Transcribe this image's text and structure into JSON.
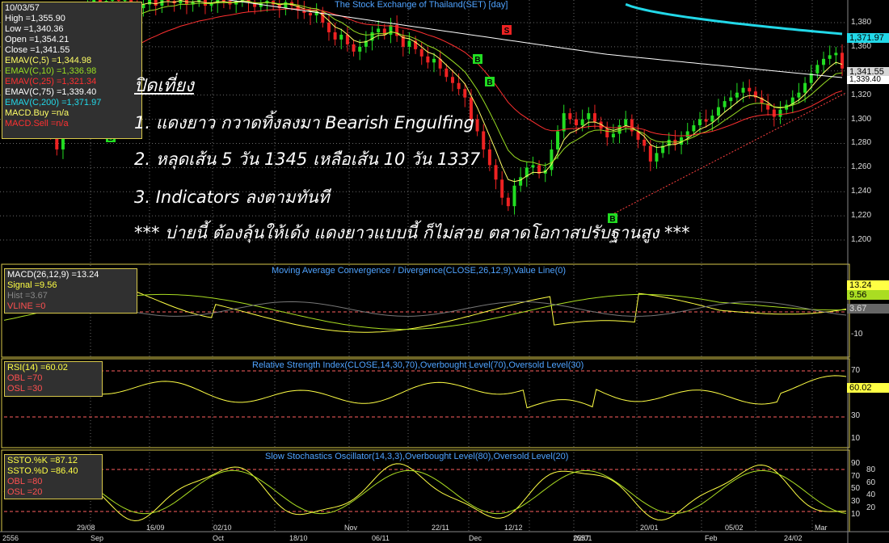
{
  "colors": {
    "up": "#22dd22",
    "down": "#ee2222",
    "grid": "#6a6a6a",
    "panel_border": "#d8c84a",
    "title": "#4fa3ff",
    "ema5": "#ffff66",
    "ema10": "#99dd22",
    "ema25": "#ff3030",
    "ema75": "#ffffff",
    "ema200": "#22d8e8",
    "macd": "#ffff44",
    "signal": "#aadd22",
    "trend": "#ff4040"
  },
  "header": {
    "title": "The Stock Exchange of Thailand(SET) [day]"
  },
  "info_box": {
    "date": "10/03/57",
    "high": "High =1,355.90",
    "low": "Low =1,340.36",
    "open": "Open =1,354.21",
    "close": "Close =1,341.55",
    "ema5": "EMAV(C,5) =1,344.98",
    "ema10": "EMAV(C,10) =1,336.98",
    "ema25": "EMAV(C,25) =1,321.34",
    "ema75": "EMAV(C,75) =1,339.40",
    "ema200": "EMAV(C,200) =1,371.97",
    "macd_buy": "MACD.Buy =n/a",
    "macd_sell": "MACD.Sell =n/a"
  },
  "annotation": {
    "heading": "ปิดเที่ยง",
    "line1": "1. แดงยาว กวาดทิ้งลงมา Bearish Engulfing",
    "line2": "2. หลุดเส้น 5 วัน 1345 เหลือเส้น 10 วัน 1337",
    "line3": "3. Indicators ลงตามทันที",
    "line4": "*** บ่ายนี้ ต้องลุ้นให้เด้ง แดงยาวแบบนี้ ก็ไม่สวย ตลาดโอกาสปรับฐานสูง ***"
  },
  "price_axis": {
    "ticks": [
      "1,380",
      "1,360",
      "1,340",
      "1,320",
      "1,300",
      "1,280",
      "1,260",
      "1,240",
      "1,220",
      "1,200"
    ],
    "badge_ema200": "1,371.97",
    "badge_close": "1,341.55",
    "badge_ema75": "1,339.40"
  },
  "signals": {
    "buy_label": "B",
    "sell_label": "S"
  },
  "macd_panel": {
    "title": "Moving Average Convergence / Divergence(CLOSE,26,12,9),Value Line(0)",
    "macd": "MACD(26,12,9) =13.24",
    "signal": "Signal =9.56",
    "hist": "Hist =3.67",
    "vline": "VLINE =0",
    "axis": [
      "-10"
    ],
    "badge_macd": "13.24",
    "badge_signal": "9.56",
    "badge_hist": "3.67"
  },
  "rsi_panel": {
    "title": "Relative Strength Index(CLOSE,14,30,70),Overbought Level(70),Oversold Level(30)",
    "rsi": "RSI(14) =60.02",
    "obl": "OBL =70",
    "osl": "OSL =30",
    "axis": [
      "70",
      "30",
      "10"
    ],
    "badge_rsi": "60.02"
  },
  "stoch_panel": {
    "title": "Slow Stochastics Oscillator(14,3,3),Overbought Level(80),Oversold Level(20)",
    "k": "SSTO.%K =87.12",
    "d": "SSTO.%D =86.40",
    "obl": "OBL =80",
    "osl": "OSL =20",
    "axis": [
      "90",
      "70",
      "50",
      "30",
      "10"
    ],
    "axis_mid": [
      "80",
      "60",
      "40",
      "20"
    ]
  },
  "x_axis": {
    "year_labels": [
      "2556",
      "2557"
    ],
    "labels": [
      "29/08",
      "Sep",
      "16/09",
      "Oct",
      "02/10",
      "18/10",
      "Nov",
      "06/11",
      "22/11",
      "Dec",
      "12/12",
      "02/01",
      "20/01",
      "Feb",
      "05/02",
      "24/02",
      "Mar"
    ]
  },
  "chart_data": {
    "type": "line",
    "title": "The Stock Exchange of Thailand(SET) [day]",
    "price": {
      "ylim": [
        1190,
        1395
      ],
      "ema200_y": [
        1398,
        1392,
        1385,
        1380,
        1377,
        1375,
        1373,
        1372,
        1371.97
      ],
      "ema75_y": [
        1375,
        1360,
        1348,
        1340,
        1335,
        1333,
        1336,
        1338,
        1339.4
      ],
      "trendline": [
        [
          1222,
          0
        ],
        [
          1322,
          0
        ]
      ],
      "last": {
        "high": 1355.9,
        "low": 1340.36,
        "open": 1354.21,
        "close": 1341.55
      }
    },
    "rsi": {
      "ylim": [
        0,
        80
      ],
      "overbought": 70,
      "oversold": 30,
      "last": 60.02
    },
    "stochastic": {
      "ylim": [
        0,
        100
      ],
      "overbought": 80,
      "oversold": 20,
      "k_last": 87.12,
      "d_last": 86.4
    },
    "macd": {
      "macd_last": 13.24,
      "signal_last": 9.56,
      "hist_last": 3.67
    }
  }
}
